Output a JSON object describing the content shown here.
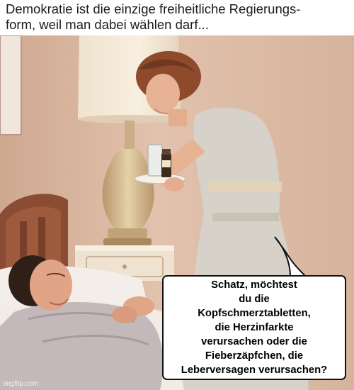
{
  "caption": {
    "text": "Demokratie ist die einzige freiheitliche Regierungs-\nform, weil man dabei wählen darf..."
  },
  "speech_bubble": {
    "text": "Schatz, möchtest\ndu die\nKopfschmerztabletten,\ndie Herzinfarkte\nverursachen oder die\nFieberzäpfchen, die\nLeberversagen verursachen?"
  },
  "watermark": {
    "text": "imgflip.com"
  },
  "colors": {
    "wall": "#d8b49c",
    "dress": "#d3cfc6",
    "pajamas": "#c3b8b9",
    "hair": "#8a4a2a",
    "skin": "#e4ad8e"
  }
}
